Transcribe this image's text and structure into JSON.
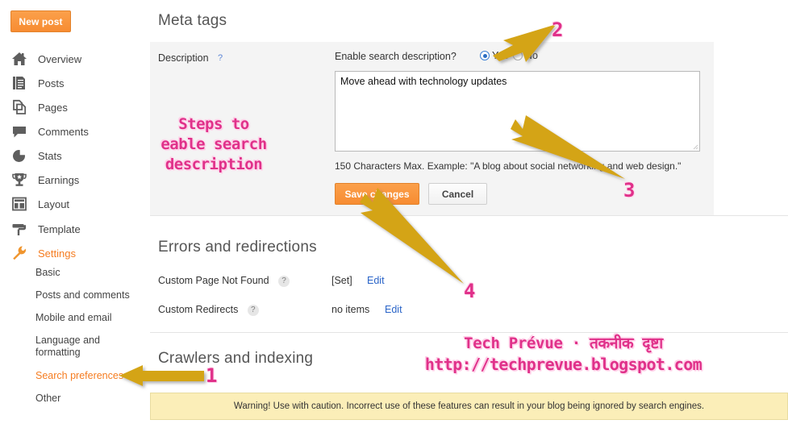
{
  "sidebar": {
    "new_post_label": "New post",
    "main_items": [
      {
        "label": "Overview",
        "icon": "home-icon",
        "active": false
      },
      {
        "label": "Posts",
        "icon": "document-lines-icon",
        "active": false
      },
      {
        "label": "Pages",
        "icon": "copy-pages-icon",
        "active": false
      },
      {
        "label": "Comments",
        "icon": "speech-bubble-icon",
        "active": false
      },
      {
        "label": "Stats",
        "icon": "pie-chart-icon",
        "active": false
      },
      {
        "label": "Earnings",
        "icon": "trophy-icon",
        "active": false
      },
      {
        "label": "Layout",
        "icon": "layout-grid-icon",
        "active": false
      },
      {
        "label": "Template",
        "icon": "paint-roller-icon",
        "active": false
      },
      {
        "label": "Settings",
        "icon": "wrench-icon",
        "active": true
      }
    ],
    "sub_items": [
      {
        "label": "Basic",
        "active": false
      },
      {
        "label": "Posts and comments",
        "active": false
      },
      {
        "label": "Mobile and email",
        "active": false
      },
      {
        "label": "Language and formatting",
        "active": false
      },
      {
        "label": "Search preferences",
        "active": true
      },
      {
        "label": "Other",
        "active": false
      }
    ]
  },
  "main": {
    "meta_tags": {
      "heading": "Meta tags",
      "description_label": "Description",
      "help_marker": "?",
      "enable_question": "Enable search description?",
      "radio_yes": "Yes",
      "radio_no": "No",
      "selected": "Yes",
      "textarea_value": "Move ahead with technology updates",
      "char_hint": "150 Characters Max. Example: \"A blog about social networking and web design.\"",
      "save_label": "Save changes",
      "cancel_label": "Cancel"
    },
    "errors": {
      "heading": "Errors and redirections",
      "rows": [
        {
          "label": "Custom Page Not Found",
          "help": "?",
          "value": "[Set]",
          "edit": "Edit"
        },
        {
          "label": "Custom Redirects",
          "help": "?",
          "value": "no items",
          "edit": "Edit"
        }
      ]
    },
    "crawlers": {
      "heading": "Crawlers and indexing"
    },
    "warning": "Warning! Use with caution. Incorrect use of these features can result in your blog being ignored by search engines."
  },
  "annotations": {
    "steps_text": "Steps to\neable search\ndescription",
    "numbers": [
      "1",
      "2",
      "3",
      "4"
    ],
    "watermark_line1": "Tech Prévue · तकनीक दृष्टा",
    "watermark_line2": "http://techprevue.blogspot.com",
    "arrow_color": "#d4a413",
    "pink": "#e0318a",
    "orange": "#f57c20"
  }
}
